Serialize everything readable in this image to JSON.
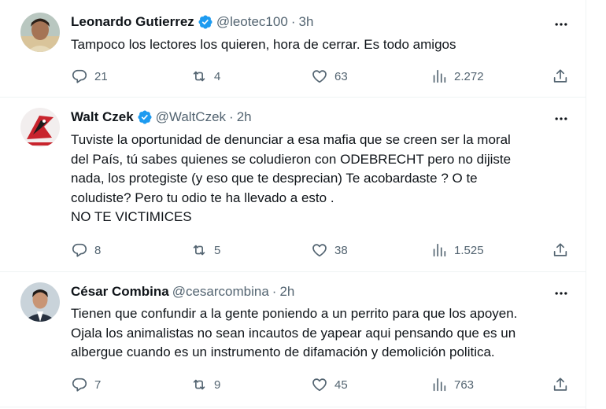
{
  "tweets": [
    {
      "name": "Leonardo Gutierrez",
      "handle": "@leotec100",
      "separator": "·",
      "time": "3h",
      "lines": [
        "Tampoco los lectores los quieren, hora de cerrar. Es todo amigos"
      ],
      "replies": "21",
      "retweets": "4",
      "likes": "63",
      "views": "2.272"
    },
    {
      "name": "Walt Czek",
      "handle": "@WaltCzek",
      "separator": "·",
      "time": "2h",
      "lines": [
        "Tuviste la oportunidad de denunciar a esa mafia que se creen ser la moral",
        "del País, tú sabes quienes se coludieron  con ODEBRECHT pero no dijiste",
        "nada, los protegiste (y eso que te desprecian) Te acobardaste ? O te",
        "coludiste? Pero tu odio te ha llevado a esto .",
        "NO TE VICTIMICES"
      ],
      "replies": "8",
      "retweets": "5",
      "likes": "38",
      "views": "1.525"
    },
    {
      "name": "César Combina",
      "handle": "@cesarcombina",
      "separator": "·",
      "time": "2h",
      "lines": [
        "Tienen que confundir a la gente poniendo a un perrito para que los apoyen.",
        "Ojala los animalistas no sean incautos de yapear aqui pensando que es un",
        "albergue cuando es un instrumento de difamación y demolición politica."
      ],
      "replies": "7",
      "retweets": "9",
      "likes": "45",
      "views": "763"
    }
  ],
  "icons": {
    "verified": "verified-badge-icon",
    "more": "more-horizontal-icon",
    "reply": "reply-bubble-icon",
    "retweet": "retweet-icon",
    "like": "heart-icon",
    "views": "views-bar-chart-icon",
    "share": "share-upload-icon"
  },
  "colors": {
    "text": "#0f1419",
    "muted": "#536471",
    "verified": "#1d9bf0",
    "divider": "#eff3f4"
  }
}
